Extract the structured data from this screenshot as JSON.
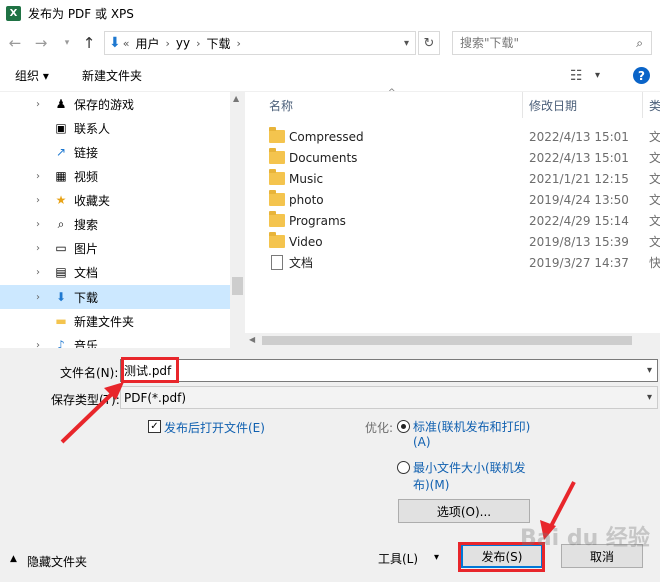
{
  "window": {
    "title": "发布为 PDF 或 XPS",
    "app_icon_letter": "X"
  },
  "address": {
    "prefix": "«",
    "segments": [
      "用户",
      "yy",
      "下载"
    ],
    "search_placeholder": "搜索\"下载\""
  },
  "toolbar": {
    "organize": "组织 ▾",
    "new_folder": "新建文件夹",
    "view_dd": "▾",
    "help": "?"
  },
  "nav": {
    "items": [
      {
        "label": "保存的游戏",
        "icon": "♟",
        "has_chevron": true
      },
      {
        "label": "联系人",
        "icon": "▣",
        "has_chevron": false
      },
      {
        "label": "链接",
        "icon": "↗",
        "has_chevron": false
      },
      {
        "label": "视频",
        "icon": "▦",
        "has_chevron": true
      },
      {
        "label": "收藏夹",
        "icon": "★",
        "has_chevron": true
      },
      {
        "label": "搜索",
        "icon": "⌕",
        "has_chevron": true
      },
      {
        "label": "图片",
        "icon": "▭",
        "has_chevron": true
      },
      {
        "label": "文档",
        "icon": "▤",
        "has_chevron": true
      },
      {
        "label": "下载",
        "icon": "⬇",
        "has_chevron": true,
        "selected": true
      },
      {
        "label": "新建文件夹",
        "icon": "▬",
        "has_chevron": false
      },
      {
        "label": "音乐",
        "icon": "♪",
        "has_chevron": true
      }
    ]
  },
  "files": {
    "headers": {
      "name": "名称",
      "date": "修改日期",
      "type": "类"
    },
    "rows": [
      {
        "name": "Compressed",
        "date": "2022/4/13 15:01",
        "type": "文",
        "kind": "folder"
      },
      {
        "name": "Documents",
        "date": "2022/4/13 15:01",
        "type": "文",
        "kind": "folder"
      },
      {
        "name": "Music",
        "date": "2021/1/21 12:15",
        "type": "文",
        "kind": "folder"
      },
      {
        "name": "photo",
        "date": "2019/4/24 13:50",
        "type": "文",
        "kind": "folder"
      },
      {
        "name": "Programs",
        "date": "2022/4/29 15:14",
        "type": "文",
        "kind": "folder"
      },
      {
        "name": "Video",
        "date": "2019/8/13 15:39",
        "type": "文",
        "kind": "folder"
      },
      {
        "name": "文档",
        "date": "2019/3/27 14:37",
        "type": "快",
        "kind": "shortcut"
      }
    ]
  },
  "form": {
    "filename_label": "文件名(N):",
    "filename_value": "测试.pdf",
    "filetype_label": "保存类型(T):",
    "filetype_value": "PDF(*.pdf)",
    "open_after_label": "发布后打开文件(E)",
    "open_after_checked": true,
    "optimize_label": "优化:",
    "opt_standard_line1": "标准(联机发布和打印)",
    "opt_standard_line2": "(A)",
    "opt_min_line1": "最小文件大小(联机发",
    "opt_min_line2": "布)(M)",
    "options_button": "选项(O)..."
  },
  "footer": {
    "hide_folders": "隐藏文件夹",
    "tools": "工具(L)",
    "publish": "发布(S)",
    "cancel": "取消"
  },
  "annotation_color": "#e8262b",
  "watermark": "Bai du 经验"
}
